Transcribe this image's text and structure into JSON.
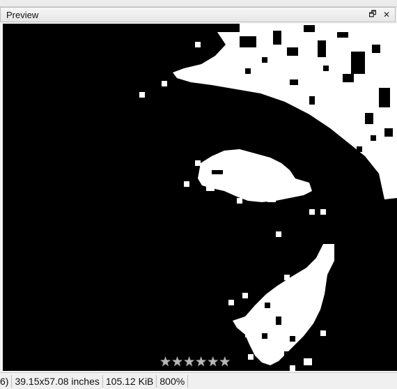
{
  "panel": {
    "title": "Preview",
    "restore_icon": "restore-window-icon",
    "close_icon": "close-icon",
    "restore_glyph": "🗗",
    "close_glyph": "✕"
  },
  "preview": {
    "zoom": "800%",
    "colors": {
      "background": "#000000",
      "foreground": "#ffffff"
    }
  },
  "rating": {
    "max": 6,
    "value": 0,
    "star_glyph": "★"
  },
  "statusbar": {
    "cells": [
      "6)",
      "39.15x57.08 inches",
      "105.12 KiB",
      "800%"
    ]
  }
}
